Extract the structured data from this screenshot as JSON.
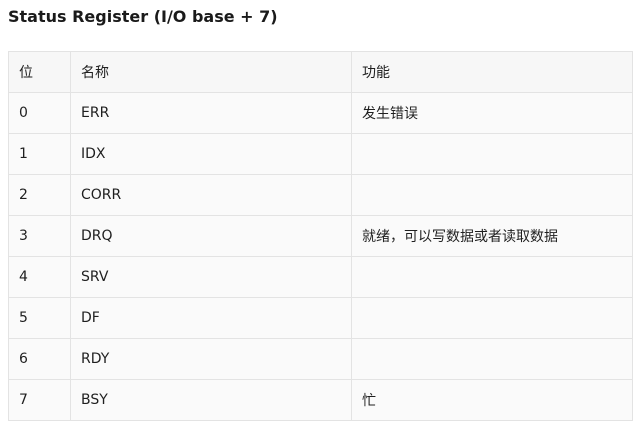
{
  "title": "Status Register (I/O base + 7)",
  "table": {
    "headers": [
      "位",
      "名称",
      "功能"
    ],
    "rows": [
      {
        "bit": "0",
        "name": "ERR",
        "function": "发生错误"
      },
      {
        "bit": "1",
        "name": "IDX",
        "function": ""
      },
      {
        "bit": "2",
        "name": "CORR",
        "function": ""
      },
      {
        "bit": "3",
        "name": "DRQ",
        "function": "就绪，可以写数据或者读取数据"
      },
      {
        "bit": "4",
        "name": "SRV",
        "function": ""
      },
      {
        "bit": "5",
        "name": "DF",
        "function": ""
      },
      {
        "bit": "6",
        "name": "RDY",
        "function": ""
      },
      {
        "bit": "7",
        "name": "BSY",
        "function": "忙"
      }
    ]
  }
}
